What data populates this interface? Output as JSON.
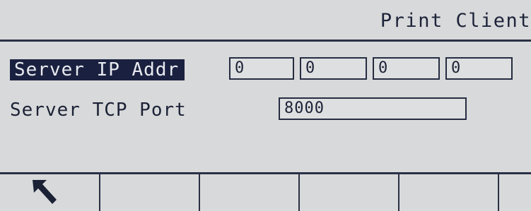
{
  "header": {
    "title": "Print Client"
  },
  "form": {
    "server_ip_label": "Server IP Addr",
    "server_ip_octets": [
      "0",
      "0",
      "0",
      "0"
    ],
    "server_port_label": "Server TCP Port",
    "server_port_value": "8000"
  },
  "softkeys": [
    {
      "icon": "back-arrow-icon"
    },
    {
      "icon": ""
    },
    {
      "icon": ""
    },
    {
      "icon": ""
    },
    {
      "icon": ""
    },
    {
      "icon": ""
    }
  ],
  "colors": {
    "background": "#d8d9da",
    "foreground": "#1b2236",
    "selection": "#1a2140"
  }
}
